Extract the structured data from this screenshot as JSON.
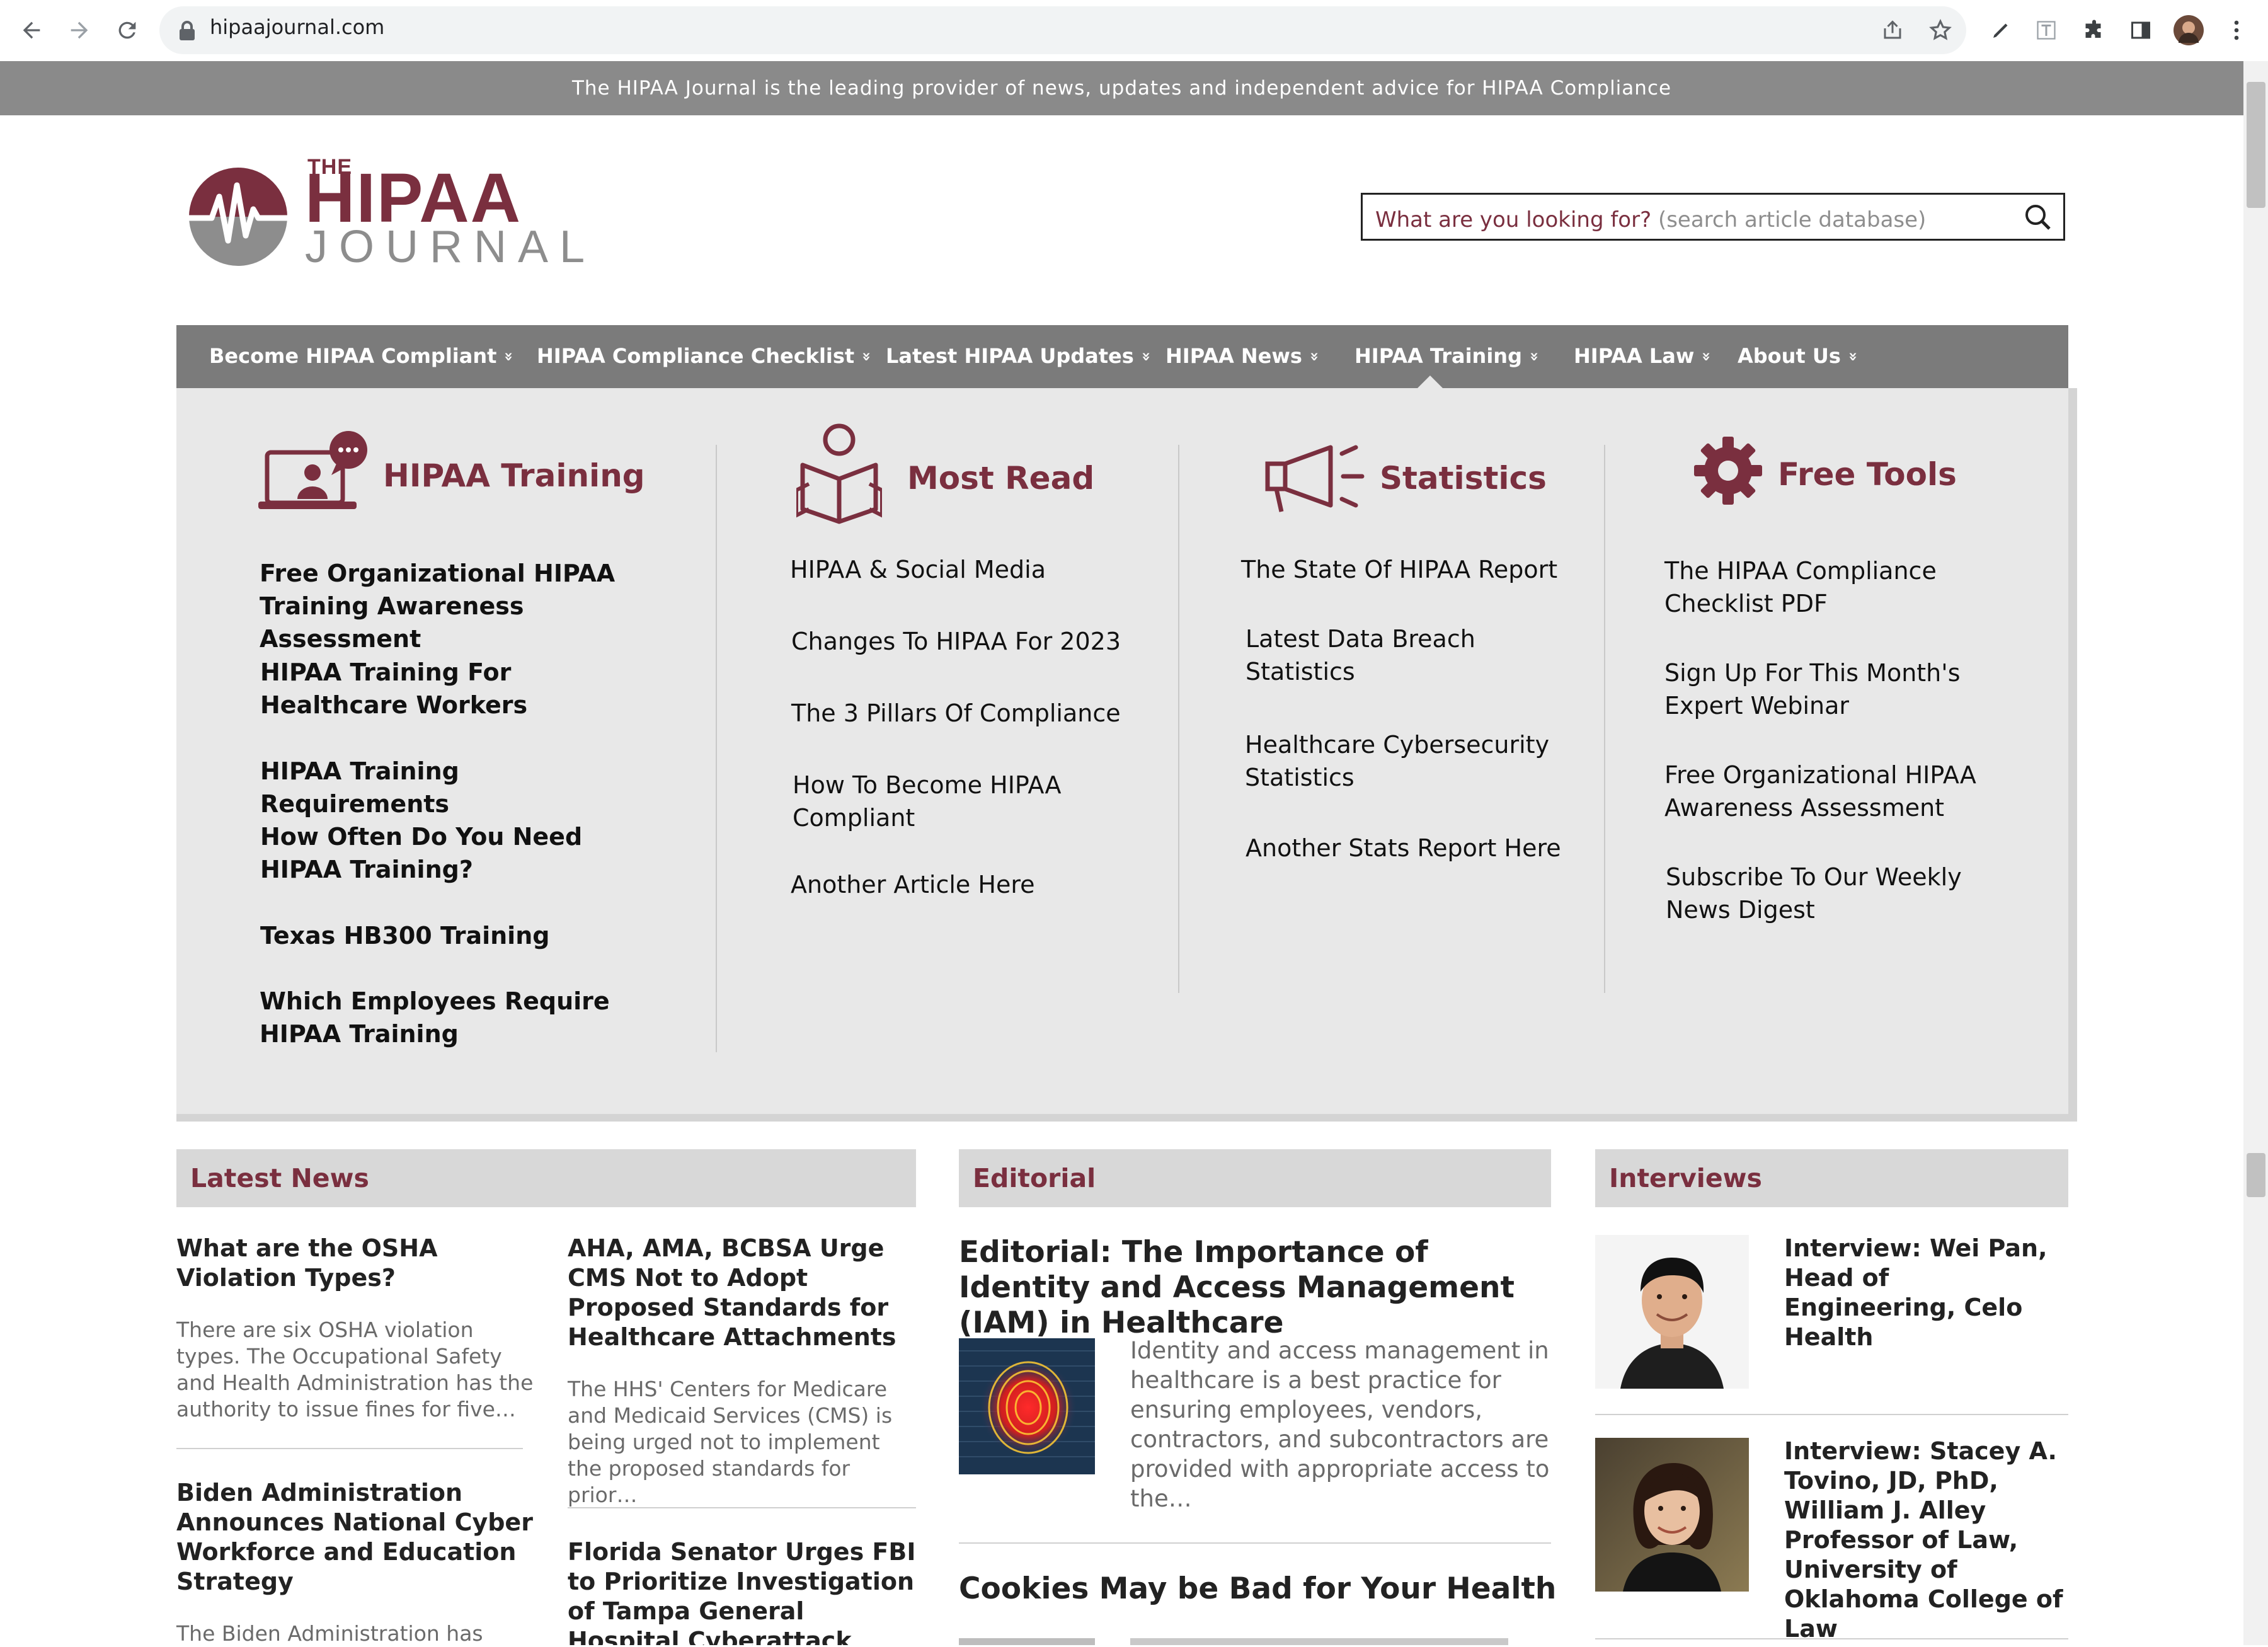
{
  "browser": {
    "url": "hipaajournal.com",
    "icons": [
      "back-icon",
      "forward-icon",
      "reload-icon",
      "lock-icon",
      "share-icon",
      "star-icon",
      "pen-icon",
      "text-icon",
      "extensions-icon",
      "sidepanel-icon",
      "avatar",
      "menu-icon"
    ]
  },
  "banner": {
    "text": "The HIPAA Journal is the leading provider of news, updates and independent advice for HIPAA Compliance"
  },
  "logo": {
    "the": "THE",
    "hipaa": "HIPAA",
    "journal": "JOURNAL"
  },
  "search": {
    "prompt": "What are you looking for?",
    "placeholder": "(search article database)"
  },
  "nav": {
    "items": [
      {
        "label": "Become HIPAA Compliant"
      },
      {
        "label": "HIPAA Compliance Checklist"
      },
      {
        "label": "Latest HIPAA Updates"
      },
      {
        "label": "HIPAA News"
      },
      {
        "label": "HIPAA Training"
      },
      {
        "label": "HIPAA Law"
      },
      {
        "label": "About Us"
      }
    ],
    "chevron": "»"
  },
  "mega": {
    "training": {
      "title": "HIPAA Training",
      "icon": "video-call-icon",
      "links": [
        "Free Organizational HIPAA Training Awareness Assessment",
        "HIPAA Training For Healthcare Workers",
        "HIPAA Training Requirements",
        "How Often Do You Need HIPAA Training?",
        "Texas HB300 Training",
        "Which Employees Require HIPAA Training"
      ]
    },
    "most_read": {
      "title": "Most Read",
      "icon": "reader-book-icon",
      "links": [
        "HIPAA & Social Media",
        "Changes To HIPAA For 2023",
        "The 3 Pillars Of Compliance",
        "How To Become HIPAA Compliant",
        "Another Article Here"
      ]
    },
    "statistics": {
      "title": "Statistics",
      "icon": "megaphone-icon",
      "links": [
        "The State Of HIPAA Report",
        "Latest Data Breach Statistics",
        "Healthcare Cybersecurity Statistics",
        "Another Stats Report Here"
      ]
    },
    "free_tools": {
      "title": "Free Tools",
      "icon": "gear-icon",
      "links": [
        "The HIPAA Compliance Checklist PDF",
        "Sign Up For This Month's Expert Webinar",
        "Free Organizational HIPAA Awareness Assessment",
        "Subscribe To Our Weekly News Digest"
      ]
    }
  },
  "latest_news": {
    "heading": "Latest News",
    "col1": [
      {
        "title": "What are the OSHA Violation Types?",
        "excerpt": "There are six OSHA violation types. The Occupational Safety and Health Administration has the authority to issue fines for five…"
      },
      {
        "title": "Biden Administration Announces National Cyber Workforce and Education Strategy",
        "excerpt": "The Biden Administration has"
      }
    ],
    "col2": [
      {
        "title": "AHA, AMA, BCBSA Urge CMS Not to Adopt Proposed Standards for Healthcare Attachments",
        "excerpt": "The HHS' Centers for Medicare and Medicaid Services (CMS) is being urged not to implement the proposed standards for prior…"
      },
      {
        "title": "Florida Senator Urges FBI to Prioritize Investigation of Tampa General Hospital Cyberattack",
        "excerpt": ""
      }
    ]
  },
  "editorial": {
    "heading": "Editorial",
    "featured": {
      "title": "Editorial: The Importance of Identity and Access Management (IAM) in Healthcare",
      "excerpt": "Identity and access management in healthcare is a best practice for ensuring employees, vendors, contractors, and subcontractors are provided with appropriate access to the…"
    },
    "second": {
      "title": "Cookies May be Bad for Your Health"
    }
  },
  "interviews": {
    "heading": "Interviews",
    "items": [
      {
        "title": "Interview: Wei Pan, Head of Engineering, Celo Health"
      },
      {
        "title": "Interview: Stacey A. Tovino, JD, PhD, William J. Alley Professor of Law, University of Oklahoma College of Law"
      }
    ]
  },
  "colors": {
    "brand": "#7a2f3f",
    "nav_bg": "#7b7b7b",
    "banner_bg": "#8a8a8a",
    "mega_bg": "#e8e8e8",
    "section_head_bg": "#d8d8d8"
  }
}
